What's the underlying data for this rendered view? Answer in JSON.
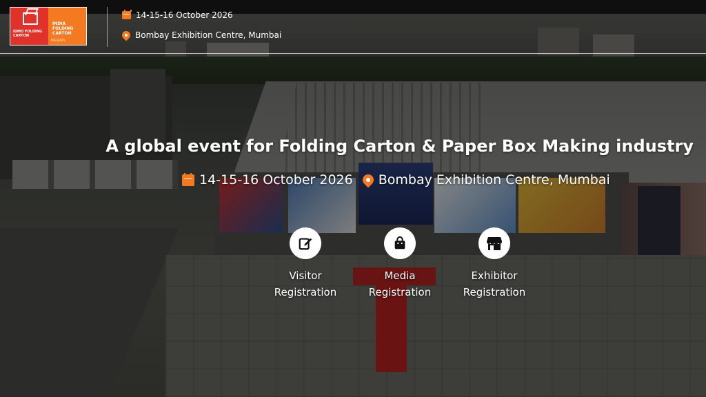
{
  "header": {
    "logo": {
      "left_text": "IDMO FOLDING CARTON",
      "right_text": "INDIA FOLDING CARTON",
      "sub_text": "PRESENTS"
    },
    "date": "14-15-16 October 2026",
    "location": "Bombay Exhibition Centre, Mumbai"
  },
  "hero": {
    "headline": "A global event for Folding Carton & Paper Box Making industry",
    "date": "14-15-16 October 2026",
    "location": "Bombay Exhibition Centre, Mumbai"
  },
  "registrations": [
    {
      "line1": "Visitor",
      "line2": "Registration",
      "icon": "edit-icon"
    },
    {
      "line1": "Media",
      "line2": "Registration",
      "icon": "bag-icon"
    },
    {
      "line1": "Exhibitor",
      "line2": "Registration",
      "icon": "store-icon"
    }
  ],
  "colors": {
    "accent": "#f47a22",
    "logo_red": "#e0312b"
  }
}
